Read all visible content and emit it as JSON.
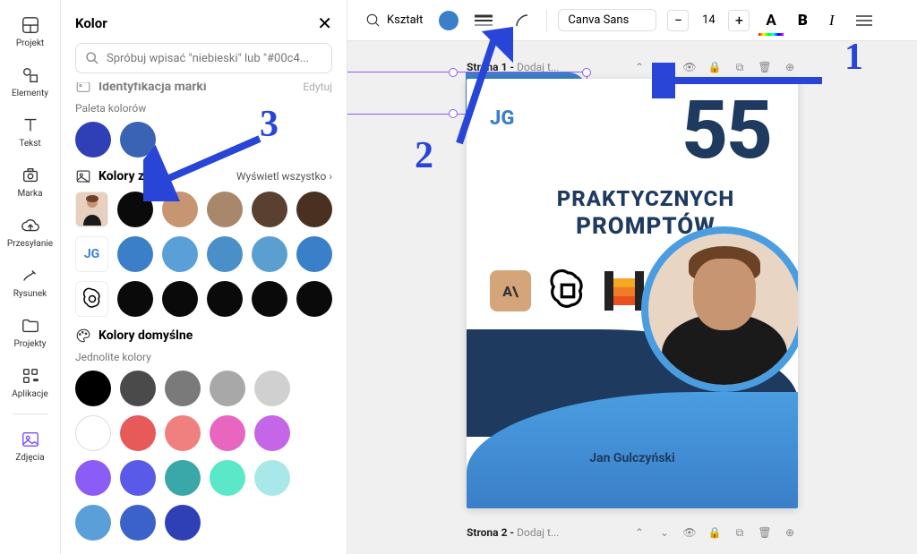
{
  "rail": [
    {
      "label": "Projekt"
    },
    {
      "label": "Elementy"
    },
    {
      "label": "Tekst"
    },
    {
      "label": "Marka"
    },
    {
      "label": "Przesyłanie"
    },
    {
      "label": "Rysunek"
    },
    {
      "label": "Projekty"
    },
    {
      "label": "Aplikacje"
    },
    {
      "label": "Zdjęcia"
    }
  ],
  "panel": {
    "title": "Kolor",
    "search_placeholder": "Spróbuj wpisać \"niebieski\" lub \"#00c4...",
    "brand_section": "Identyfikacja marki",
    "brand_action": "Edytuj",
    "palette_label": "Paleta kolorów",
    "palette_colors": [
      "#2f3fb5",
      "#3a62b5"
    ],
    "photo_title": "Kolory zdjęć",
    "photo_action": "Wyświetl wszystko",
    "photo_rows": [
      {
        "ref": "person",
        "colors": [
          "#0a0a0a",
          "#c79572",
          "#a8876a",
          "#5a4030",
          "#4a3020"
        ]
      },
      {
        "ref": "jg",
        "colors": [
          "#3a7fc8",
          "#5a9fd8",
          "#4a8fc8",
          "#5a9fd0",
          "#3a80c8"
        ]
      },
      {
        "ref": "openai",
        "colors": [
          "#0a0a0a",
          "#0a0a0a",
          "#0a0a0a",
          "#0a0a0a",
          "#0a0a0a"
        ]
      }
    ],
    "default_title": "Kolory domyślne",
    "solid_label": "Jednolite kolory",
    "default_colors": [
      "#000000",
      "#4a4a4a",
      "#7a7a7a",
      "#a8a8a8",
      "#d0d0d0",
      "#ffffff",
      "#e85a5a",
      "#f08080",
      "#e865c0",
      "#c565e8",
      "#8b5cf6",
      "#5a5ae8",
      "#3aa8a8",
      "#5ae8c8",
      "#a8e8e8",
      "#5a9fd8",
      "#3a62c8",
      "#2f3fb5"
    ]
  },
  "toolbar": {
    "shape_label": "Kształt",
    "shape_color": "#3a7fc8",
    "font": "Canva Sans",
    "font_size": "14"
  },
  "page1": {
    "strip_title": "Strona 1 - ",
    "strip_add": "Dodaj t...",
    "jg": "JG",
    "big": "55",
    "line1": "PRAKTYCZNYCH",
    "line2": "PROMPTÓW",
    "ai_badge": "A\\",
    "author": "Jan Gulczyński"
  },
  "page2": {
    "strip_title": "Strona 2 - ",
    "strip_add": "Dodaj t..."
  },
  "annotations": {
    "one": "1",
    "two": "2",
    "three": "3"
  },
  "chart_data": null
}
